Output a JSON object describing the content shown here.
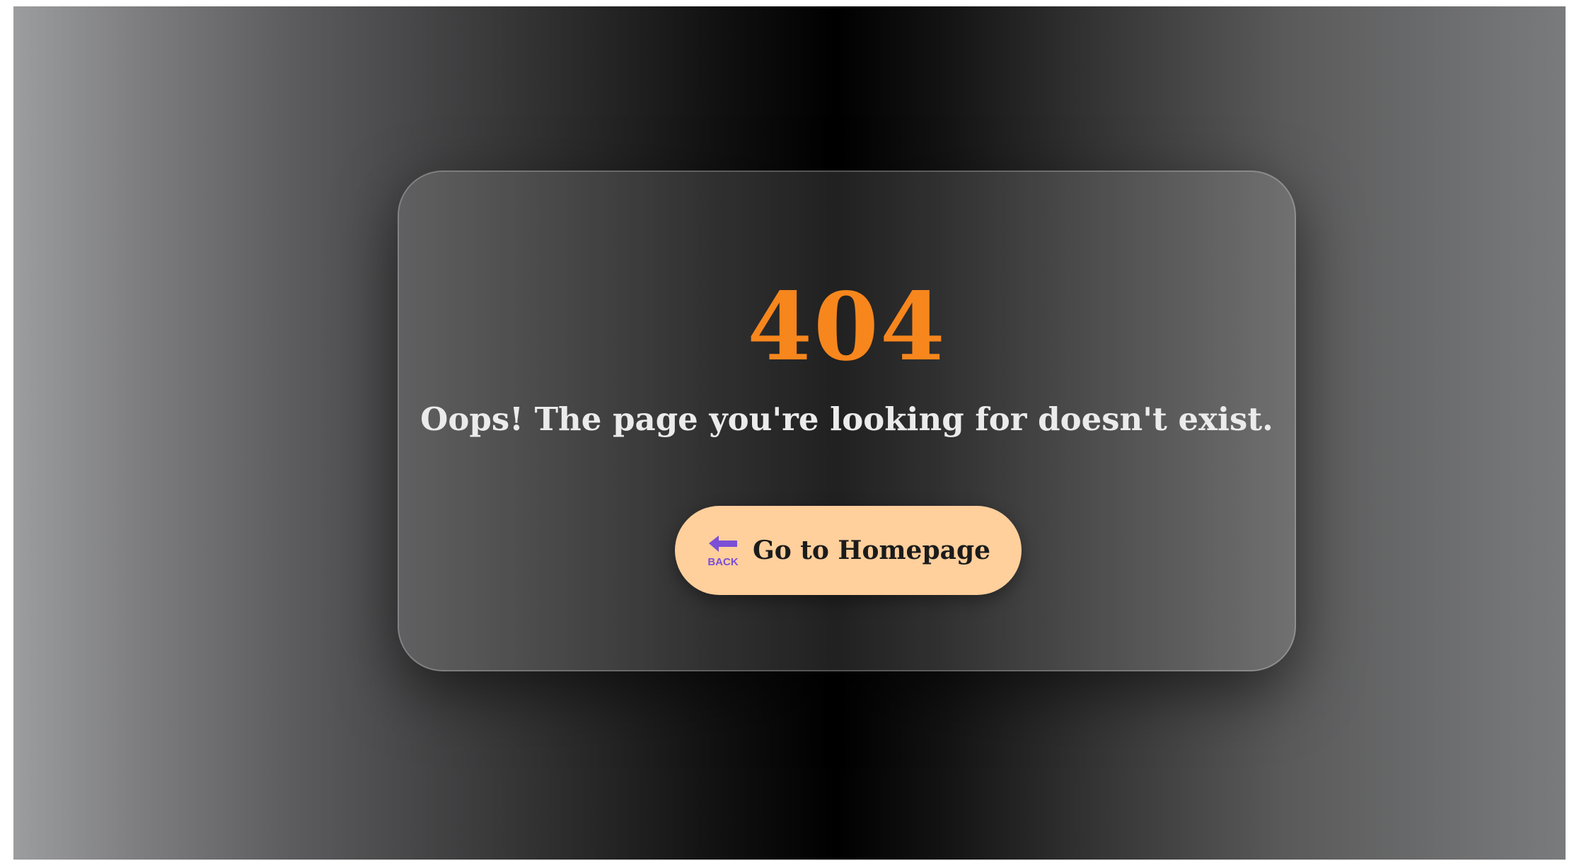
{
  "error_page": {
    "code": "404",
    "message": "Oops! The page you're looking for doesn't exist.",
    "button": {
      "label": "Go to Homepage",
      "icon": "back-arrow-icon",
      "icon_caption": "BACK"
    }
  },
  "colors": {
    "accent": "#f7861d",
    "button_bg": "#ffcf9c",
    "icon": "#7b4fd6",
    "message_text": "#ebebeb"
  }
}
